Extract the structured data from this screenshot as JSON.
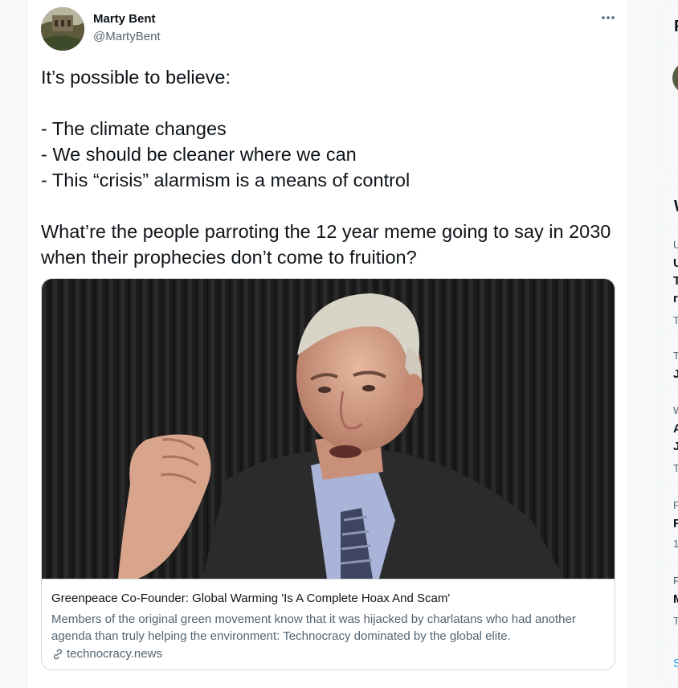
{
  "tweet": {
    "author_name": "Marty Bent",
    "author_handle": "@MartyBent",
    "lines": [
      "It’s possible to believe:",
      "",
      "- The climate changes",
      "- We should be cleaner where we can",
      "- This “crisis” alarmism is a means of control",
      "",
      "What’re the people parroting the 12 year meme going to say in 2030 when their prophecies don’t come to fruition?"
    ]
  },
  "card": {
    "title": "Greenpeace Co-Founder: Global Warming 'Is A Complete Hoax And Scam'",
    "description": "Members of the original green movement know that it was hijacked by charlatans who had another agenda than truly helping the environment: Technocracy dominated by the global elite.",
    "domain": "technocracy.news"
  },
  "sidebar": {
    "box1_header": "F",
    "box2_header": "W",
    "trends": [
      {
        "l1": "U",
        "l2": "U",
        "l3": "T",
        "l4": "r",
        "l5": "T"
      },
      {
        "l1": "T",
        "l2": "J"
      },
      {
        "l1": "W",
        "l2": "A",
        "l3": "J",
        "l4": "T"
      },
      {
        "l1": "P",
        "l2": "F",
        "l3": "1"
      },
      {
        "l1": "P",
        "l2": "M",
        "l3": "T"
      }
    ],
    "show_more": "S"
  },
  "icons": {
    "more": "more-horizontal-icon",
    "link": "link-icon"
  }
}
